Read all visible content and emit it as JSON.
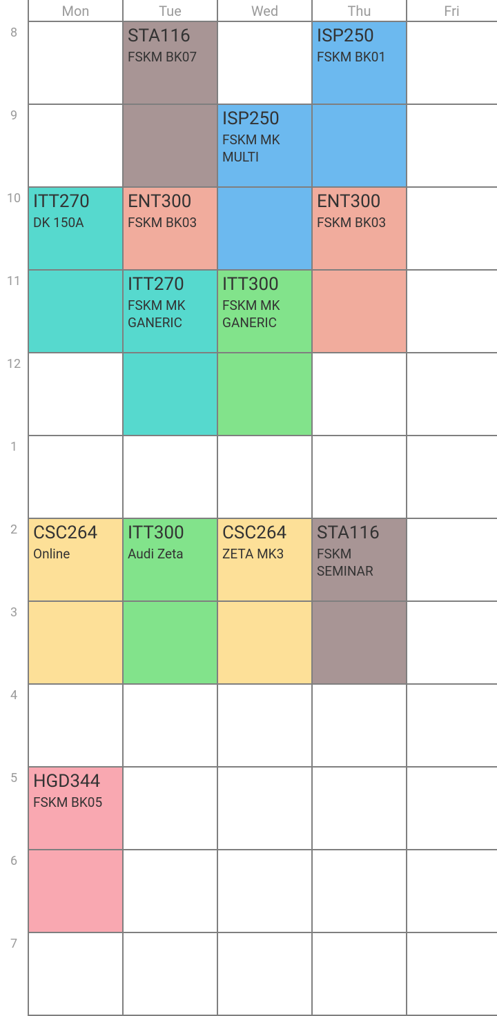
{
  "days": [
    "Mon",
    "Tue",
    "Wed",
    "Thu",
    "Fri"
  ],
  "hours": [
    "8",
    "9",
    "10",
    "11",
    "12",
    "1",
    "2",
    "3",
    "4",
    "5",
    "6",
    "7"
  ],
  "colors": {
    "grid_line": "#7f7f7f",
    "label_text": "#9a9a9a",
    "event_text": "#333333"
  },
  "events": [
    {
      "code": "STA116",
      "room": "FSKM BK07",
      "day": 1,
      "start": 8,
      "end": 10,
      "color": "#a89595"
    },
    {
      "code": "ISP250",
      "room": "FSKM BK01",
      "day": 3,
      "start": 8,
      "end": 10,
      "color": "#6cb9ef"
    },
    {
      "code": "ISP250",
      "room": "FSKM MK MULTI",
      "day": 2,
      "start": 9,
      "end": 11,
      "color": "#6cb9ef"
    },
    {
      "code": "ITT270",
      "room": "DK 150A",
      "day": 0,
      "start": 10,
      "end": 12,
      "color": "#56d9ce"
    },
    {
      "code": "ENT300",
      "room": "FSKM BK03",
      "day": 1,
      "start": 10,
      "end": 11,
      "color": "#f1ac9d"
    },
    {
      "code": "ENT300",
      "room": "FSKM BK03",
      "day": 3,
      "start": 10,
      "end": 12,
      "color": "#f1ac9d"
    },
    {
      "code": "ITT270",
      "room": "FSKM MK GANERIC",
      "day": 1,
      "start": 11,
      "end": 13,
      "color": "#56d9ce"
    },
    {
      "code": "ITT300",
      "room": "FSKM MK GANERIC",
      "day": 2,
      "start": 11,
      "end": 13,
      "color": "#82e38b"
    },
    {
      "code": "CSC264",
      "room": "Online",
      "day": 0,
      "start": 14,
      "end": 16,
      "color": "#fde098"
    },
    {
      "code": "ITT300",
      "room": "Audi Zeta",
      "day": 1,
      "start": 14,
      "end": 16,
      "color": "#82e38b"
    },
    {
      "code": "CSC264",
      "room": "ZETA MK3",
      "day": 2,
      "start": 14,
      "end": 16,
      "color": "#fde098"
    },
    {
      "code": "STA116",
      "room": "FSKM SEMINAR",
      "day": 3,
      "start": 14,
      "end": 16,
      "color": "#a89595"
    },
    {
      "code": "HGD344",
      "room": "FSKM BK05",
      "day": 0,
      "start": 17,
      "end": 19,
      "color": "#f9a8b1"
    }
  ]
}
